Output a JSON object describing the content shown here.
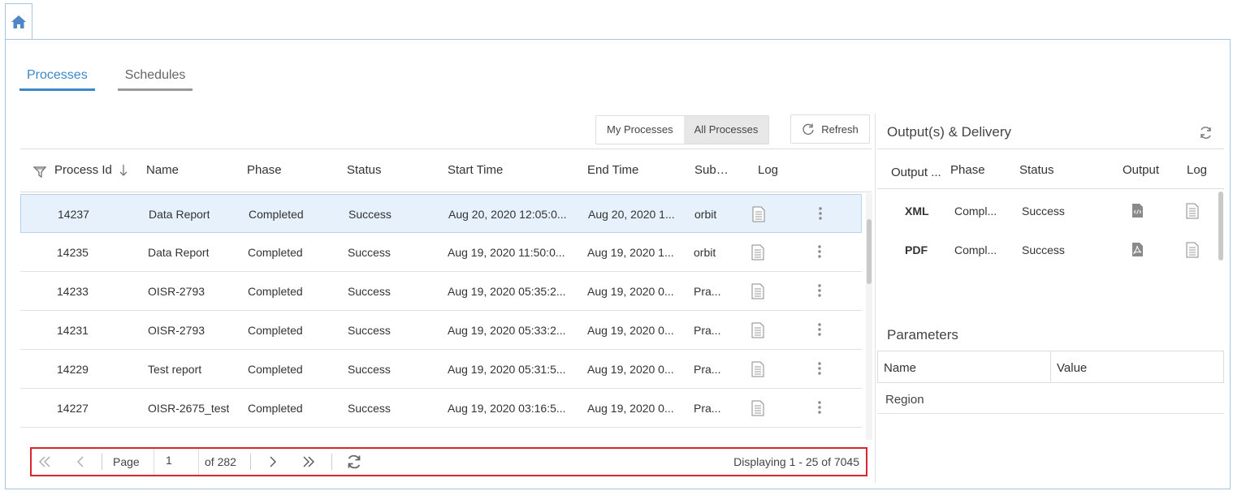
{
  "tabs": [
    "Processes",
    "Schedules"
  ],
  "toolbar": {
    "my_processes": "My Processes",
    "all_processes": "All Processes",
    "refresh": "Refresh"
  },
  "grid": {
    "columns": [
      "Process Id",
      "Name",
      "Phase",
      "Status",
      "Start Time",
      "End Time",
      "Sub…",
      "Log"
    ],
    "rows": [
      {
        "id": "14237",
        "name": "Data Report",
        "phase": "Completed",
        "status": "Success",
        "start": "Aug 20, 2020 12:05:0...",
        "end": "Aug 20, 2020 1...",
        "sub": "orbit"
      },
      {
        "id": "14235",
        "name": "Data Report",
        "phase": "Completed",
        "status": "Success",
        "start": "Aug 19, 2020 11:50:0...",
        "end": "Aug 19, 2020 1...",
        "sub": "orbit"
      },
      {
        "id": "14233",
        "name": "OISR-2793",
        "phase": "Completed",
        "status": "Success",
        "start": "Aug 19, 2020 05:35:2...",
        "end": "Aug 19, 2020 0...",
        "sub": "Pra..."
      },
      {
        "id": "14231",
        "name": "OISR-2793",
        "phase": "Completed",
        "status": "Success",
        "start": "Aug 19, 2020 05:33:2...",
        "end": "Aug 19, 2020 0...",
        "sub": "Pra..."
      },
      {
        "id": "14229",
        "name": "Test report",
        "phase": "Completed",
        "status": "Success",
        "start": "Aug 19, 2020 05:31:5...",
        "end": "Aug 19, 2020 0...",
        "sub": "Pra..."
      },
      {
        "id": "14227",
        "name": "OISR-2675_test",
        "phase": "Completed",
        "status": "Success",
        "start": "Aug 19, 2020 03:16:5...",
        "end": "Aug 19, 2020 0...",
        "sub": "Pra..."
      }
    ]
  },
  "pager": {
    "page_label": "Page",
    "page_value": "1",
    "of_label": "of 282",
    "display": "Displaying 1 - 25 of 7045"
  },
  "output": {
    "title": "Output(s) & Delivery",
    "columns": [
      "Output ...",
      "Phase",
      "Status",
      "Output",
      "Log"
    ],
    "rows": [
      {
        "type": "XML",
        "phase": "Compl...",
        "status": "Success"
      },
      {
        "type": "PDF",
        "phase": "Compl...",
        "status": "Success"
      }
    ]
  },
  "parameters": {
    "title": "Parameters",
    "columns": [
      "Name",
      "Value"
    ],
    "rows": [
      {
        "name": "Region",
        "value": ""
      }
    ]
  },
  "colors": {
    "accent": "#3d87c9",
    "selected_row": "#e6f1fb",
    "pager_border": "#d9262e"
  },
  "icons": [
    "home-icon",
    "filter-icon",
    "sort-down-icon",
    "refresh-icon",
    "log-icon",
    "more-icon",
    "xml-file-icon",
    "pdf-file-icon",
    "first-page-icon",
    "prev-page-icon",
    "next-page-icon",
    "last-page-icon"
  ]
}
